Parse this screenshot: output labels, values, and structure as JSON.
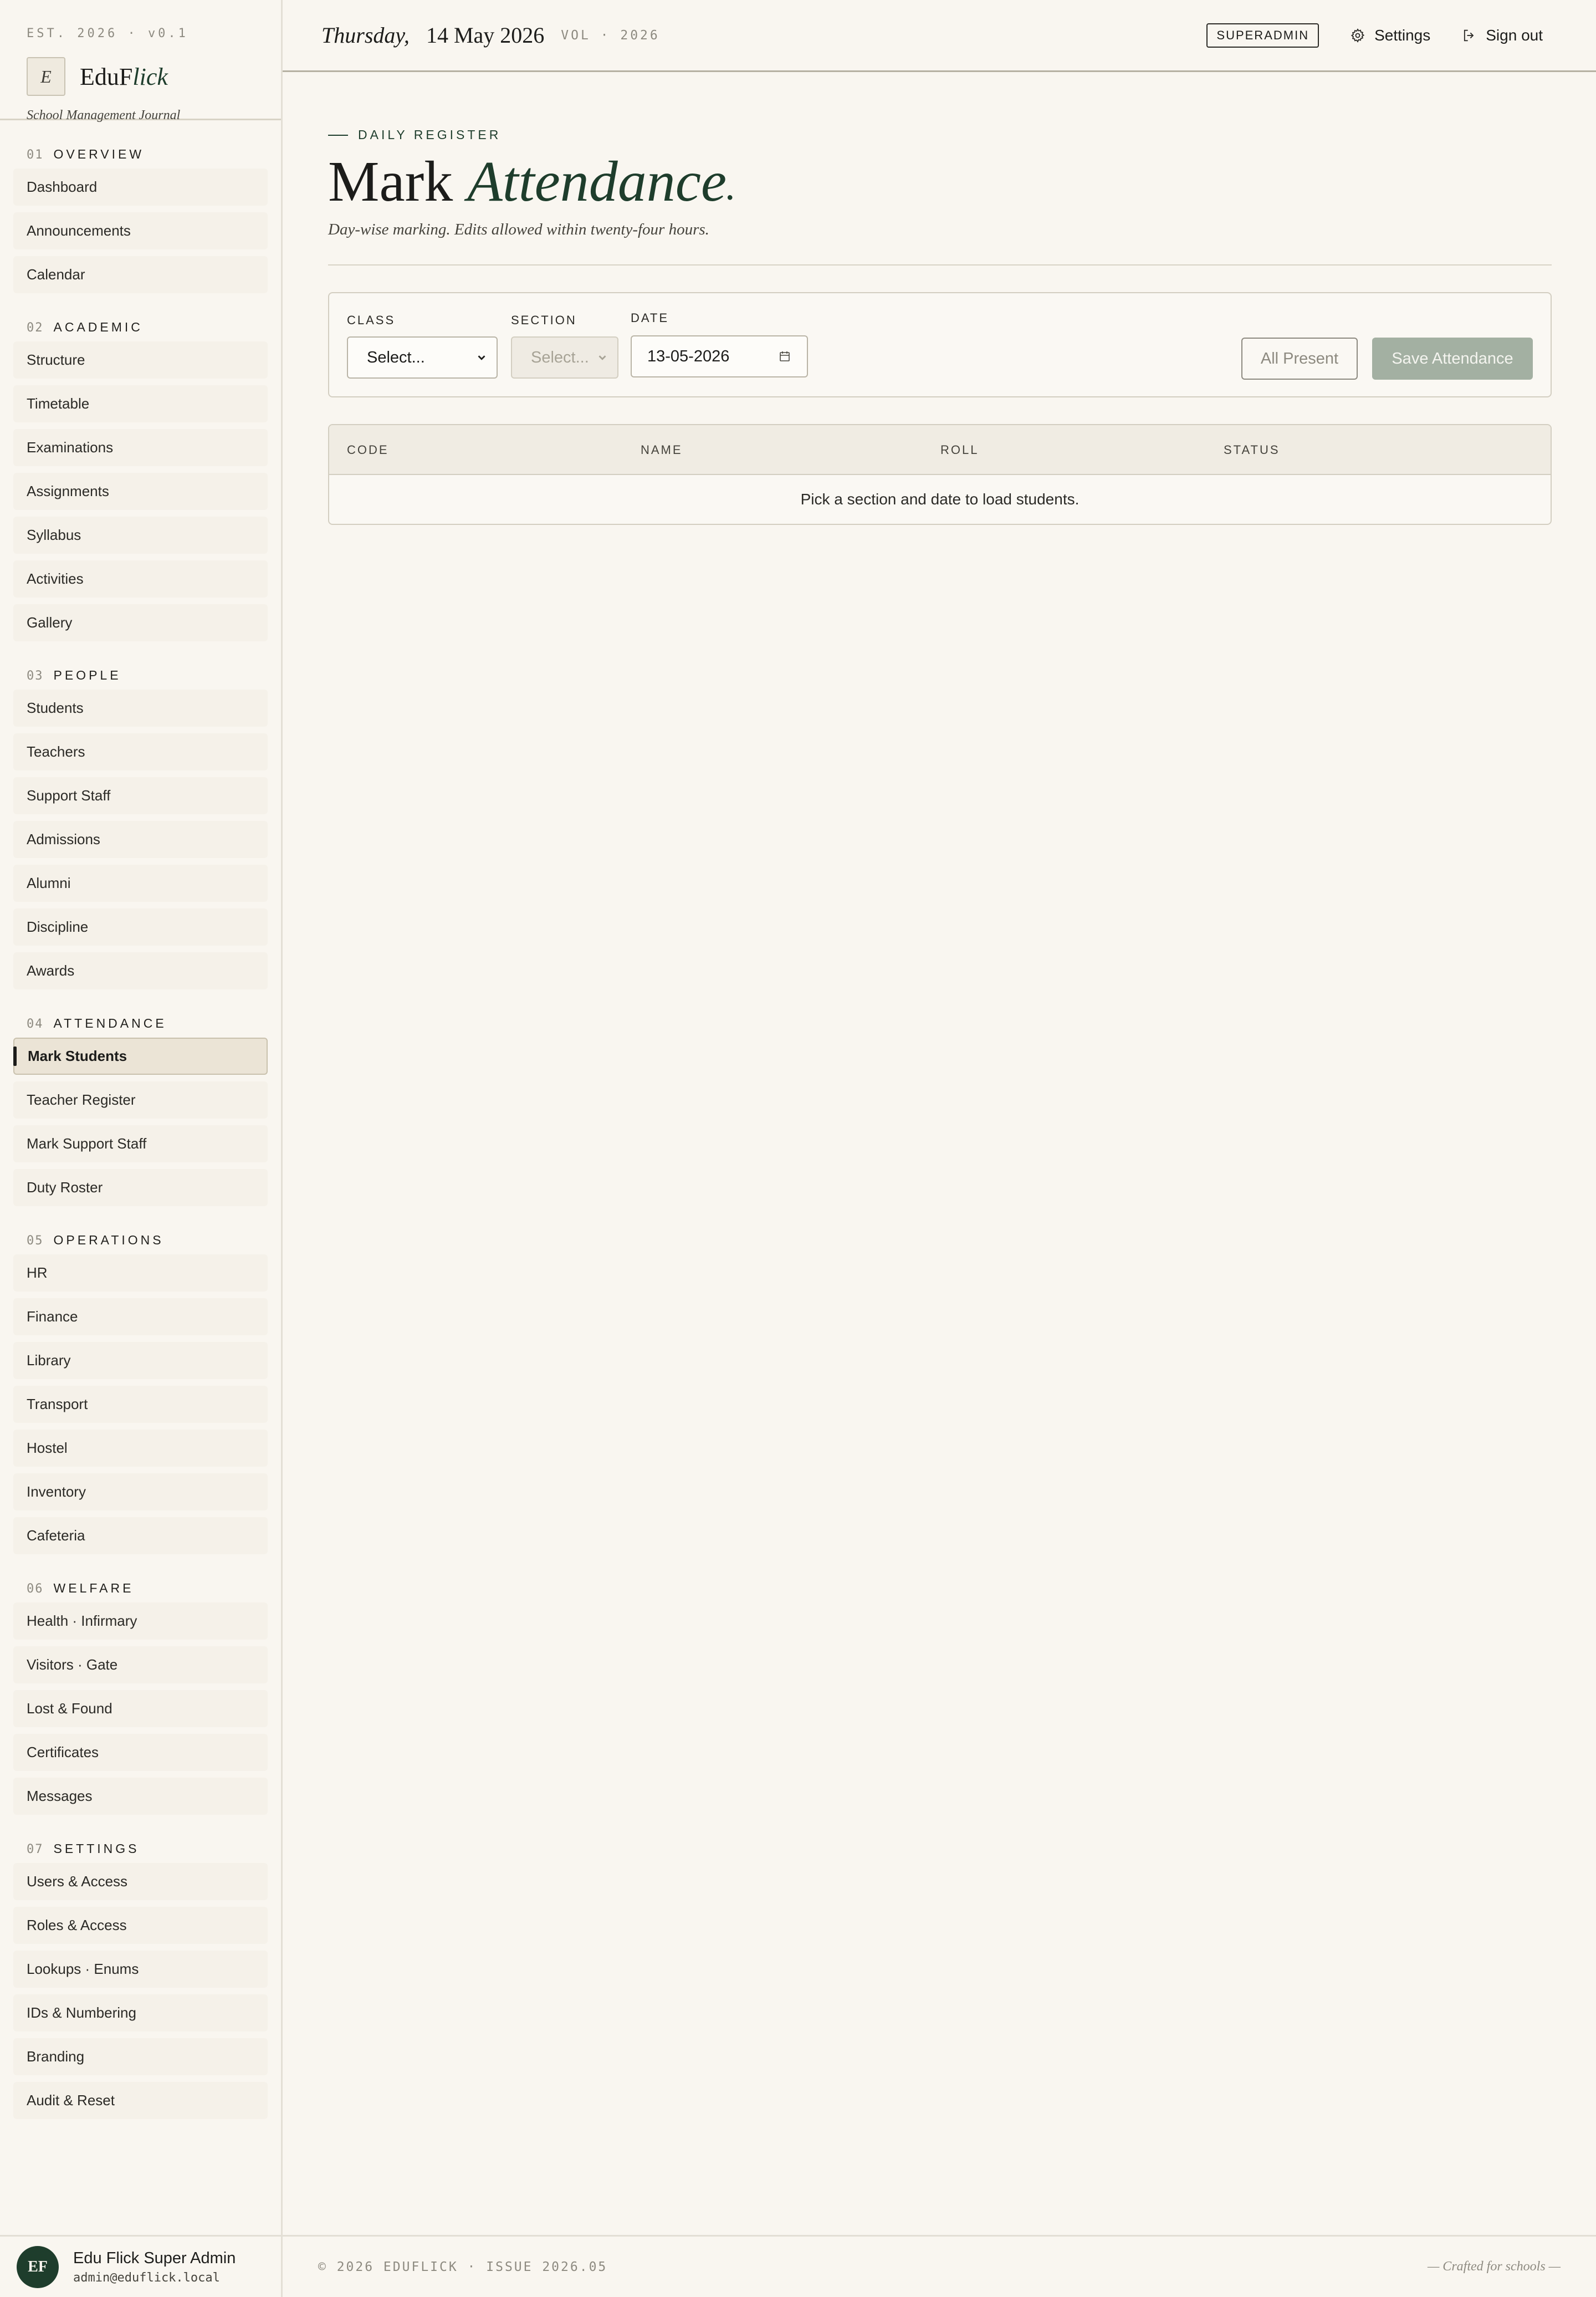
{
  "brand": {
    "est": "EST. 2026 · v0.1",
    "logo_mark": "E",
    "name_plain": "Edu",
    "name_bold": "F",
    "name_italic": "lick",
    "tagline": "School Management Journal"
  },
  "sidebar": {
    "sections": [
      {
        "num": "01",
        "title": "OVERVIEW",
        "items": [
          "Dashboard",
          "Announcements",
          "Calendar"
        ]
      },
      {
        "num": "02",
        "title": "ACADEMIC",
        "items": [
          "Structure",
          "Timetable",
          "Examinations",
          "Assignments",
          "Syllabus",
          "Activities",
          "Gallery"
        ]
      },
      {
        "num": "03",
        "title": "PEOPLE",
        "items": [
          "Students",
          "Teachers",
          "Support Staff",
          "Admissions",
          "Alumni",
          "Discipline",
          "Awards"
        ]
      },
      {
        "num": "04",
        "title": "ATTENDANCE",
        "items": [
          "Mark Students",
          "Teacher Register",
          "Mark Support Staff",
          "Duty Roster"
        ]
      },
      {
        "num": "05",
        "title": "OPERATIONS",
        "items": [
          "HR",
          "Finance",
          "Library",
          "Transport",
          "Hostel",
          "Inventory",
          "Cafeteria"
        ]
      },
      {
        "num": "06",
        "title": "WELFARE",
        "items": [
          "Health · Infirmary",
          "Visitors · Gate",
          "Lost & Found",
          "Certificates",
          "Messages"
        ]
      },
      {
        "num": "07",
        "title": "SETTINGS",
        "items": [
          "Users & Access",
          "Roles & Access",
          "Lookups · Enums",
          "IDs & Numbering",
          "Branding",
          "Audit & Reset"
        ]
      }
    ],
    "active_item": "Mark Students"
  },
  "user": {
    "initials": "EF",
    "name": "Edu Flick Super Admin",
    "email": "admin@eduflick.local"
  },
  "topbar": {
    "day": "Thursday,",
    "date": "14 May 2026",
    "vol": "VOL · 2026",
    "role": "SUPERADMIN",
    "settings_label": "Settings",
    "signout_label": "Sign out"
  },
  "page": {
    "eyebrow": "DAILY REGISTER",
    "title_plain": "Mark",
    "title_italic": "Attendance",
    "subtitle": "Day-wise marking. Edits allowed within twenty-four hours."
  },
  "filters": {
    "class_label": "CLASS",
    "class_value": "Select...",
    "section_label": "SECTION",
    "section_value": "Select...",
    "date_label": "DATE",
    "date_value": "13-05-2026",
    "all_present_label": "All Present",
    "save_label": "Save Attendance"
  },
  "table": {
    "columns": [
      "CODE",
      "NAME",
      "ROLL",
      "STATUS"
    ],
    "empty_message": "Pick a section and date to load students."
  },
  "footer": {
    "copy": "© 2026 EDUFLICK · ISSUE 2026.05",
    "crafted": "— Crafted for schools —"
  },
  "colors": {
    "accent": "#1e3d2c",
    "background": "#f9f6f0",
    "save_button": "#a3b0a2"
  }
}
